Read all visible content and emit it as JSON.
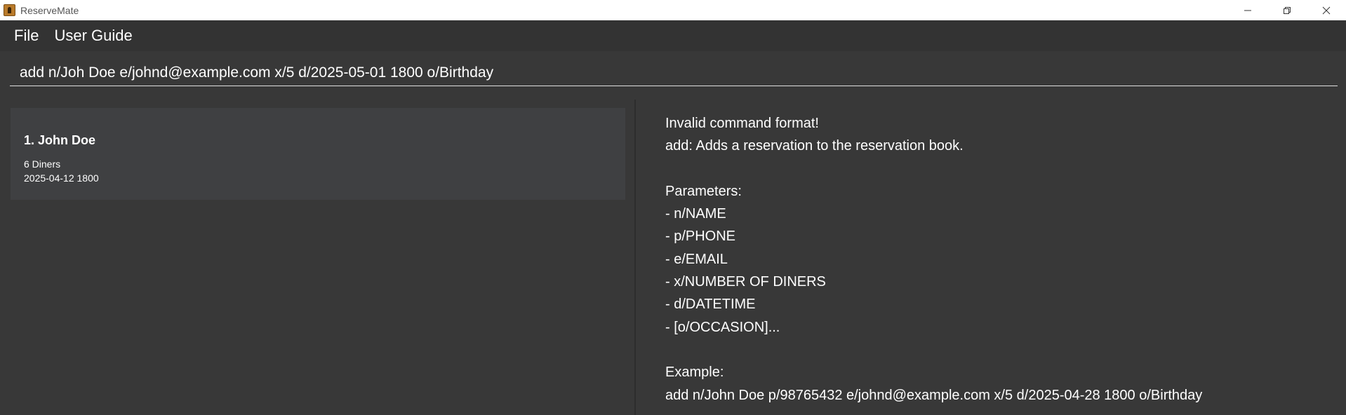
{
  "window": {
    "title": "ReserveMate",
    "icon": "app-icon"
  },
  "menu": {
    "file_label": "File",
    "user_guide_label": "User Guide"
  },
  "command": {
    "value": "add n/Joh Doe e/johnd@example.com x/5 d/2025-05-01 1800 o/Birthday"
  },
  "reservations": [
    {
      "name": "1. John Doe",
      "diners": "6 Diners",
      "datetime": "2025-04-12 1800"
    }
  ],
  "result": {
    "message": "Invalid command format!\nadd: Adds a reservation to the reservation book.\n\nParameters:\n- n/NAME\n- p/PHONE\n- e/EMAIL\n- x/NUMBER OF DINERS\n- d/DATETIME\n- [o/OCCASION]...\n\nExample:\nadd n/John Doe p/98765432 e/johnd@example.com x/5 d/2025-04-28 1800 o/Birthday"
  },
  "colors": {
    "background": "#383838",
    "menubar": "#333333",
    "card": "#3f4042",
    "text": "#ffffff"
  }
}
